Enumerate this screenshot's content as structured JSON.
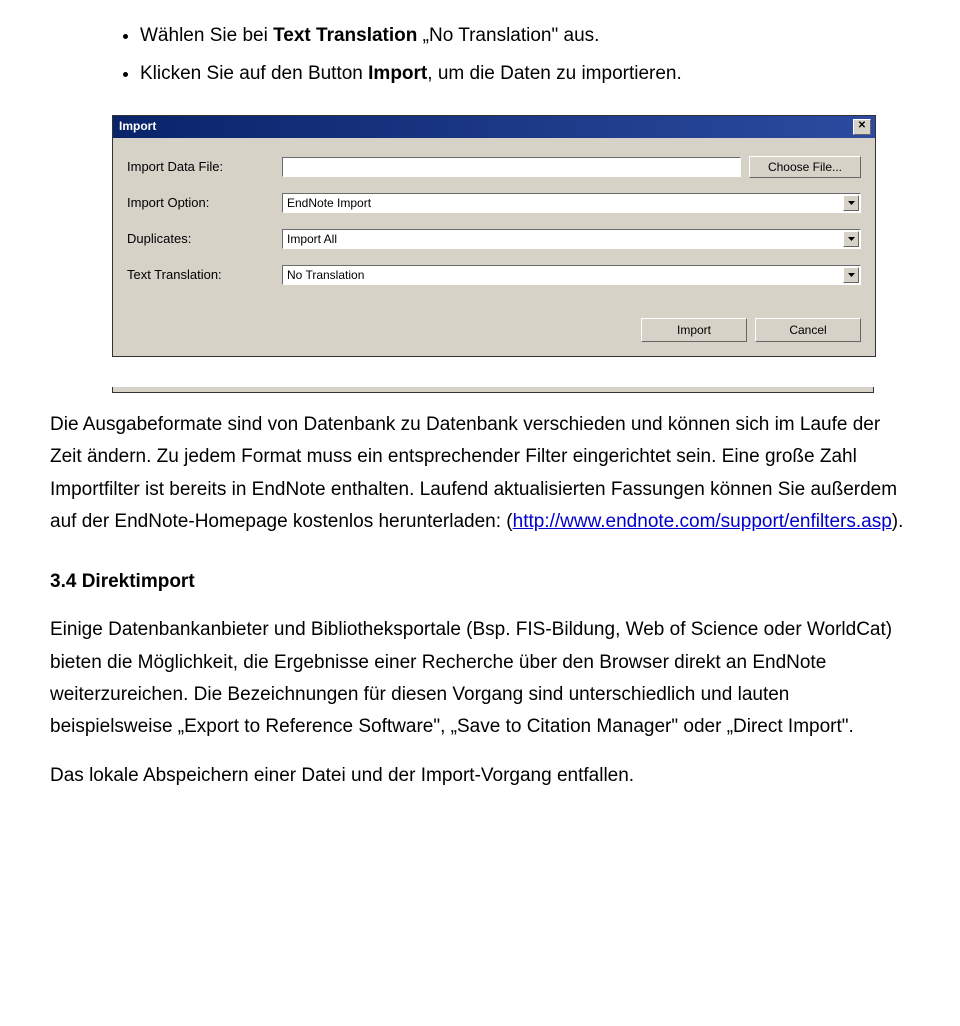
{
  "bullets": {
    "b1_pre": "Wählen Sie bei ",
    "b1_bold1": "Text Translation",
    "b1_mid": " „No Translation\" aus.",
    "b2_pre": "Klicken Sie auf den Button ",
    "b2_bold": "Import",
    "b2_post": ", um die Daten zu importieren."
  },
  "dialog": {
    "title": "Import",
    "close_glyph": "✕",
    "rows": {
      "data_file_label": "Import Data File:",
      "data_file_value": "",
      "choose_file_label": "Choose File...",
      "import_option_label": "Import Option:",
      "import_option_value": "EndNote Import",
      "duplicates_label": "Duplicates:",
      "duplicates_value": "Import All",
      "text_translation_label": "Text Translation:",
      "text_translation_value": "No Translation"
    },
    "buttons": {
      "import": "Import",
      "cancel": "Cancel"
    }
  },
  "para1": {
    "t1": "Die Ausgabeformate sind von Datenbank zu Datenbank verschieden und können sich im Laufe der Zeit ändern. Zu jedem Format muss ein entsprechender Filter eingerichtet sein. Eine große Zahl Importfilter ist bereits in EndNote enthalten. Laufend aktualisierten Fassungen können Sie außerdem auf der EndNote-Homepage kostenlos herunterladen: (",
    "link": "http://www.endnote.com/support/enfilters.asp",
    "t2": ")."
  },
  "heading34": "3.4 Direktimport",
  "para2": "Einige Datenbankanbieter und Bibliotheksportale (Bsp. FIS-Bildung, Web of Science oder WorldCat) bieten die Möglichkeit, die Ergebnisse einer Recherche über den Browser direkt an EndNote weiterzureichen. Die Bezeichnungen für diesen Vorgang sind unterschiedlich und lauten beispielsweise „Export to Reference Software\", „Save to Citation Manager\" oder „Direct Import\".",
  "para3": "Das lokale Abspeichern einer Datei und der Import-Vorgang entfallen."
}
